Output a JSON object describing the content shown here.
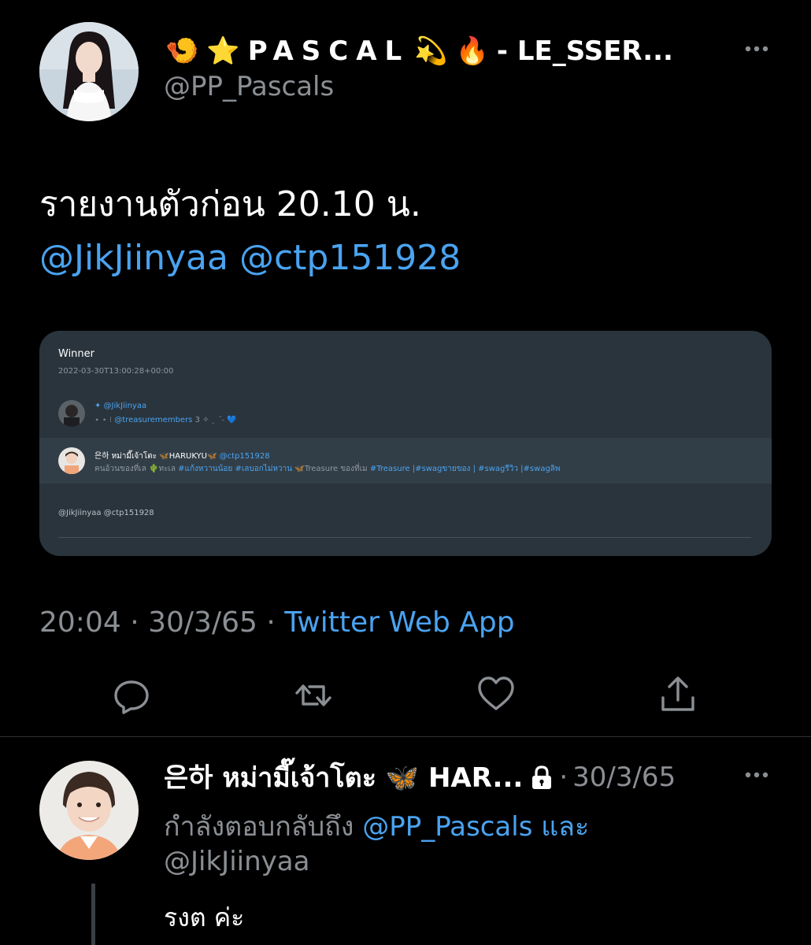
{
  "tweet": {
    "emojis": [
      "🍤",
      "⭐"
    ],
    "name_letters": "PASCAL",
    "name_emojis": [
      "💫",
      "🔥"
    ],
    "name_suffix": "- LE_SSER...",
    "more_icon": "more-horizontal-icon",
    "handle": "@PP_Pascals",
    "text": "รายงานตัวก่อน 20.10 น.",
    "mentions": "@JikJiinyaa @ctp151928",
    "time": "20:04",
    "date": "30/3/65",
    "separator": "·",
    "source": "Twitter Web App",
    "action_icons": [
      "reply-icon",
      "retweet-icon",
      "like-icon",
      "share-icon"
    ]
  },
  "card": {
    "title": "Winner",
    "timestamp": "2022-03-30T13:00:28+00:00",
    "entry1": {
      "handle": "✦ @JikJiinyaa",
      "desc_prefix": "⋆ ⋆ ⁝",
      "desc_mention": "@treasuremembers",
      "desc_suffix": "3 ✧ ˎ ˊ˗ 💙"
    },
    "entry2": {
      "name": "은하 หม่ามี๊เจ้าโตะ 🦋HARUKYU🦋",
      "handle": "@ctp151928",
      "desc_prefix": "คนอ้วนของที่เล 🌵ทะเล",
      "desc_tags": "#แก้งหวานน้อย #เลบอกไม่หวาน",
      "desc_mid": "🦋Treasure ของที่เม",
      "desc_tags2": "#Treasure |#swagขายของ | #swagรีวิว |#swagลิพ"
    },
    "footer": "@JikJiinyaa @ctp151928"
  },
  "reply": {
    "name": "은하 หม่ามี๊เจ้าโตะ 🦋 HAR...",
    "lock_icon": "lock-icon",
    "separator": "·",
    "date": "30/3/65",
    "more_icon": "more-horizontal-icon",
    "replying_prefix": "กำลังตอบกลับถึง",
    "replying_user1": "@PP_Pascals",
    "replying_and": "และ",
    "replying_user2": "@JikJiinyaa",
    "text": "รงต ค่ะ"
  },
  "colors": {
    "link": "#4aa3f0",
    "muted": "#8b8f94",
    "card_bg": "#2a343c"
  }
}
